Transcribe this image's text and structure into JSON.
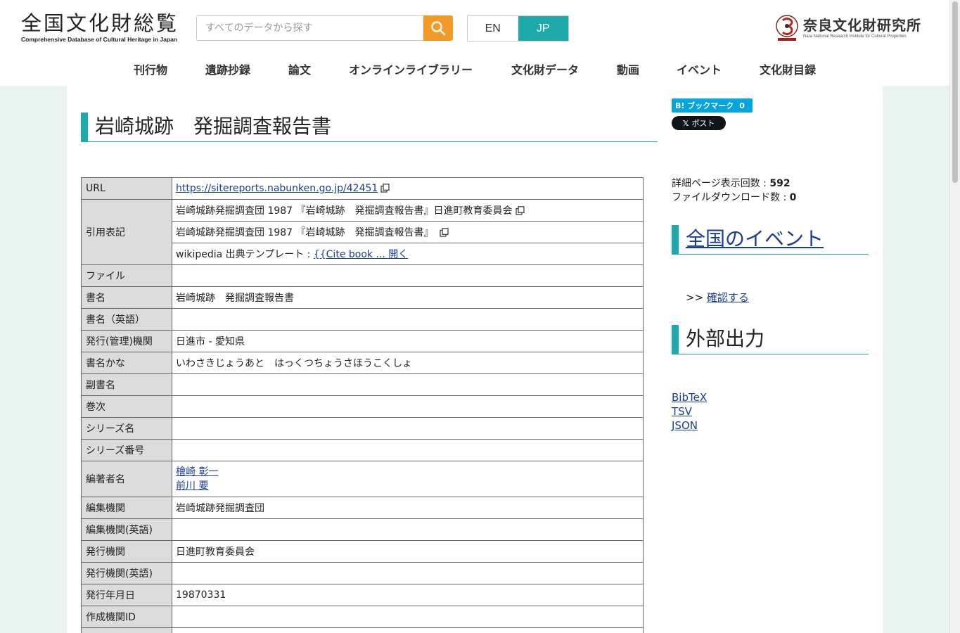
{
  "header": {
    "logo_main": "全国文化財総覧",
    "logo_sub": "Comprehensive Database of Cultural Heritage in Japan",
    "search_placeholder": "すべてのデータから探す",
    "lang_en": "EN",
    "lang_jp": "JP",
    "org_main": "奈良文化財研究所",
    "org_sub": "Nara National Research Institute for Cultural Properties"
  },
  "nav": [
    "刊行物",
    "遺跡抄録",
    "論文",
    "オンラインライブラリー",
    "文化財データ",
    "動画",
    "イベント",
    "文化財目録"
  ],
  "page": {
    "title": "岩崎城跡　発掘調査報告書"
  },
  "table": {
    "url_label": "URL",
    "url_value": "https://sitereports.nabunken.go.jp/42451",
    "citation_label": "引用表記",
    "citation_1": "岩崎城跡発掘調査団 1987 『岩崎城跡　発掘調査報告書』日進町教育委員会",
    "citation_2": "岩崎城跡発掘調査団 1987 『岩崎城跡　発掘調査報告書』",
    "citation_3_prefix": "wikipedia 出典テンプレート : ",
    "citation_3_link": "{{Cite book ... 開く",
    "rows": [
      {
        "k": "ファイル",
        "v": ""
      },
      {
        "k": "書名",
        "v": "岩崎城跡　発掘調査報告書"
      },
      {
        "k": "書名（英語）",
        "v": ""
      },
      {
        "k": "発行(管理)機関",
        "v": "日進市 - 愛知県"
      },
      {
        "k": "書名かな",
        "v": "いわさきじょうあと　はっくつちょうさほうこくしょ"
      },
      {
        "k": "副書名",
        "v": ""
      },
      {
        "k": "巻次",
        "v": ""
      },
      {
        "k": "シリーズ名",
        "v": ""
      },
      {
        "k": "シリーズ番号",
        "v": ""
      }
    ],
    "authors_label": "編著者名",
    "authors": [
      "檜崎 彰一",
      "前川 要"
    ],
    "rows2": [
      {
        "k": "編集機関",
        "v": "岩崎城跡発掘調査団"
      },
      {
        "k": "編集機関(英語)",
        "v": ""
      },
      {
        "k": "発行機関",
        "v": "日進町教育委員会"
      },
      {
        "k": "発行機関(英語)",
        "v": ""
      },
      {
        "k": "発行年月日",
        "v": "19870331"
      },
      {
        "k": "作成機関ID",
        "v": ""
      },
      {
        "k": "",
        "v": ""
      }
    ]
  },
  "sidebar": {
    "hatena_label": "B! ブックマーク",
    "hatena_count": "0",
    "x_label": "ポスト",
    "views_label": "詳細ページ表示回数 : ",
    "views_value": "592",
    "downloads_label": "ファイルダウンロード数 : ",
    "downloads_value": "0",
    "events_heading": "全国のイベント",
    "confirm_prefix": ">> ",
    "confirm_link": "確認する",
    "export_heading": "外部出力",
    "exports": [
      "BibTeX",
      "TSV",
      "JSON"
    ]
  }
}
